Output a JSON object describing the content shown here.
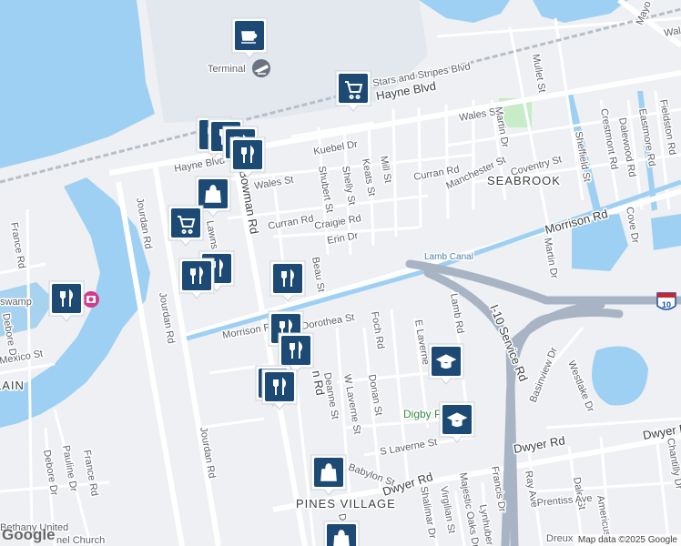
{
  "map": {
    "areas": {
      "seabrook": "SEABROOK",
      "pines_village": "PINES VILLAGE",
      "airport_terminal": "Terminal",
      "digby": "Digby P",
      "swamp": "swamp",
      "church_line1": "Bethany United",
      "church_line2": "nel Church",
      "lain": "LAIN"
    },
    "water": {
      "lamb_canal": "Lamb Canal"
    },
    "shields": {
      "i10": "10"
    },
    "roads": {
      "stars_stripes": "Stars and Stripes Blvd",
      "hayne_blvd_upper": "Hayne Blvd",
      "hayne_blvd_lower": "Hayne Blvd",
      "kuebel": "Kuebel Dr",
      "wales_left": "Wales St",
      "wales_right": "Wales St",
      "shubert": "Shubert St",
      "shelly": "Shelly St",
      "keats": "Keats St",
      "mill": "Mill St",
      "curran_left": "Curran Rd",
      "curran_right": "Curran Rd",
      "manchester": "Manchester St",
      "coventry": "Coventry St",
      "craigie": "Craigie Rd",
      "erin": "Erin Dr",
      "beau": "Beau St",
      "morrison_left": "Morrison Rd",
      "morrison_right": "Morrison Rd",
      "dorothea": "Dorothea St",
      "foch": "Foch Rd",
      "lamb": "Lamb Rd",
      "e_laverne": "E Laverne",
      "i10_service": "I-10 Service Rd",
      "basinview": "Basinview Dr",
      "westlake": "Westlake Dr",
      "deanne": "Deanne St",
      "w_laverne": "W Laverne St",
      "dorian": "Dorian St",
      "s_laverne": "S Laverne St",
      "babylon": "Babylon St",
      "dwyer_left": "Dwyer Rd",
      "dwyer_mid": "Dwyer Rd",
      "dwyer_right": "Dwyer Rd",
      "shalimar": "Shalimar Dr",
      "virgilian": "Virgilian St",
      "majestic_oaks": "Majestic Oaks Dr",
      "lynhuber": "Lynhuber",
      "francis": "Francis Dr",
      "ray": "Ray Ave",
      "dale": "Dale St",
      "prentiss": "Prentiss Ave",
      "americus": "Americus",
      "chantilly": "Chantilly Dr",
      "dreux": "Dreux",
      "jourdan_upper": "Jourdan Rd",
      "jourdan_mid": "Jourdan Rd",
      "jourdan_lower": "Jourdan Rd",
      "bowman": "Bowman Rd",
      "bowman_lower": "n Rd",
      "france_upper": "France Rd",
      "france_lower": "France Rd",
      "debore_upper": "Debore Dr",
      "debore_lower": "Debore Dr",
      "pauline": "Pauline Dr",
      "mexico": "Mexico St",
      "mayo": "Mayo Rd",
      "wales_far": "Wal",
      "mullet": "Mullet St",
      "martin_upper": "Martin Dr",
      "martin_lower": "Martin Dr",
      "sheffield": "Sheffield St",
      "crestmont": "Crestmont Rd",
      "dalewood": "Dalewood Rd",
      "eastmore": "Eastmore Rd",
      "fieldston": "Fieldston Rd",
      "cove": "Cove Dr",
      "do_partial": "Do",
      "lawns": "Lawns"
    }
  },
  "attribution": "Map data ©2025 Google",
  "google_logo": "Google",
  "colors": {
    "water": "#9dd0f3",
    "park": "#c8ebc8",
    "highway": "#a8b4c4",
    "road": "#ffffff",
    "land": "#eef0f3",
    "pin": "#1d4a74"
  }
}
